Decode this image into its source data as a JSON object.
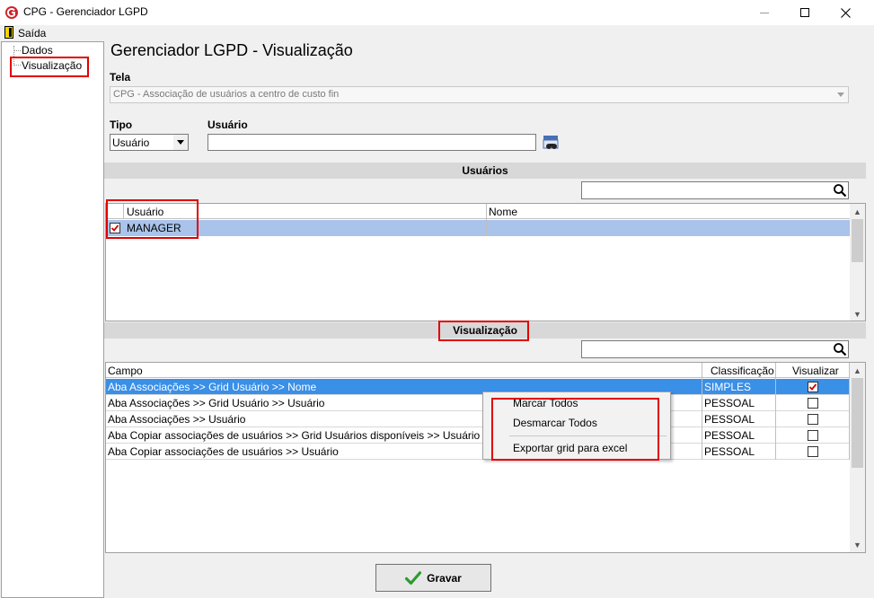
{
  "window": {
    "title": "CPG - Gerenciador LGPD",
    "minimize_glyph": "—",
    "maximize_glyph": "☐",
    "close_glyph": "✕"
  },
  "menu": {
    "exit_label": "Saída"
  },
  "tree": {
    "items": [
      {
        "label": "Dados"
      },
      {
        "label": "Visualização"
      }
    ]
  },
  "header": {
    "title": "Gerenciador LGPD - Visualização",
    "tela_label": "Tela",
    "tela_value": "CPG - Associação de usuários a centro de custo fin",
    "tipo_label": "Tipo",
    "tipo_value": "Usuário",
    "usuario_label": "Usuário",
    "usuario_value": ""
  },
  "users_section": {
    "title": "Usuários",
    "search_value": "",
    "columns": [
      "Usuário",
      "Nome"
    ],
    "rows": [
      {
        "usuario": "MANAGER",
        "nome": "",
        "checked": true
      }
    ]
  },
  "vis_section": {
    "title": "Visualização",
    "search_value": "",
    "columns": [
      "Campo",
      "Classificação",
      "Visualizar"
    ],
    "rows": [
      {
        "campo": "Aba Associações >> Grid Usuário >> Nome",
        "classificacao": "SIMPLES",
        "visualizar": true,
        "selected": true
      },
      {
        "campo": "Aba Associações >> Grid Usuário >> Usuário",
        "classificacao": "PESSOAL",
        "visualizar": false,
        "selected": false
      },
      {
        "campo": "Aba Associações >> Usuário",
        "classificacao": "PESSOAL",
        "visualizar": false,
        "selected": false
      },
      {
        "campo": "Aba Copiar associações de usuários >> Grid Usuários disponíveis >> Usuário",
        "classificacao": "PESSOAL",
        "visualizar": false,
        "selected": false
      },
      {
        "campo": "Aba Copiar associações de usuários >> Usuário",
        "classificacao": "PESSOAL",
        "visualizar": false,
        "selected": false
      }
    ]
  },
  "context_menu": {
    "items": [
      "Marcar Todos",
      "Desmarcar Todos",
      "Exportar grid para excel"
    ]
  },
  "footer": {
    "save_label": "Gravar"
  },
  "colors": {
    "selection": "#3a8fe6",
    "user_row": "#a9c3ea",
    "annotation": "#e00000",
    "check_mark": "#d00000",
    "save_icon": "#2e9a2e"
  },
  "icons": {
    "app": "cpg-logo-icon",
    "exit": "exit-door-icon",
    "find": "binoculars-icon",
    "search": "magnifier-icon",
    "save": "checkmark-icon"
  }
}
